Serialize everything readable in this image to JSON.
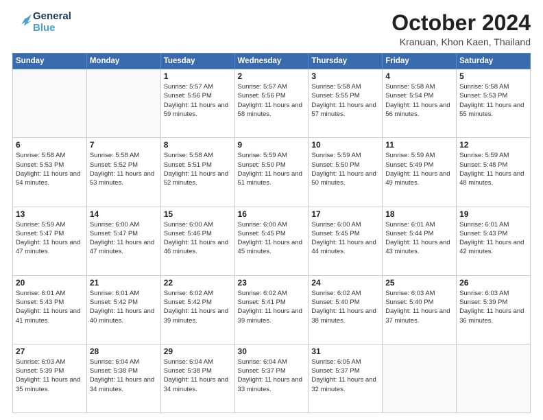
{
  "header": {
    "logo_line1": "General",
    "logo_line2": "Blue",
    "month": "October 2024",
    "location": "Kranuan, Khon Kaen, Thailand"
  },
  "weekdays": [
    "Sunday",
    "Monday",
    "Tuesday",
    "Wednesday",
    "Thursday",
    "Friday",
    "Saturday"
  ],
  "weeks": [
    [
      {
        "day": "",
        "info": ""
      },
      {
        "day": "",
        "info": ""
      },
      {
        "day": "1",
        "info": "Sunrise: 5:57 AM\nSunset: 5:56 PM\nDaylight: 11 hours and 59 minutes."
      },
      {
        "day": "2",
        "info": "Sunrise: 5:57 AM\nSunset: 5:56 PM\nDaylight: 11 hours and 58 minutes."
      },
      {
        "day": "3",
        "info": "Sunrise: 5:58 AM\nSunset: 5:55 PM\nDaylight: 11 hours and 57 minutes."
      },
      {
        "day": "4",
        "info": "Sunrise: 5:58 AM\nSunset: 5:54 PM\nDaylight: 11 hours and 56 minutes."
      },
      {
        "day": "5",
        "info": "Sunrise: 5:58 AM\nSunset: 5:53 PM\nDaylight: 11 hours and 55 minutes."
      }
    ],
    [
      {
        "day": "6",
        "info": "Sunrise: 5:58 AM\nSunset: 5:53 PM\nDaylight: 11 hours and 54 minutes."
      },
      {
        "day": "7",
        "info": "Sunrise: 5:58 AM\nSunset: 5:52 PM\nDaylight: 11 hours and 53 minutes."
      },
      {
        "day": "8",
        "info": "Sunrise: 5:58 AM\nSunset: 5:51 PM\nDaylight: 11 hours and 52 minutes."
      },
      {
        "day": "9",
        "info": "Sunrise: 5:59 AM\nSunset: 5:50 PM\nDaylight: 11 hours and 51 minutes."
      },
      {
        "day": "10",
        "info": "Sunrise: 5:59 AM\nSunset: 5:50 PM\nDaylight: 11 hours and 50 minutes."
      },
      {
        "day": "11",
        "info": "Sunrise: 5:59 AM\nSunset: 5:49 PM\nDaylight: 11 hours and 49 minutes."
      },
      {
        "day": "12",
        "info": "Sunrise: 5:59 AM\nSunset: 5:48 PM\nDaylight: 11 hours and 48 minutes."
      }
    ],
    [
      {
        "day": "13",
        "info": "Sunrise: 5:59 AM\nSunset: 5:47 PM\nDaylight: 11 hours and 47 minutes."
      },
      {
        "day": "14",
        "info": "Sunrise: 6:00 AM\nSunset: 5:47 PM\nDaylight: 11 hours and 47 minutes."
      },
      {
        "day": "15",
        "info": "Sunrise: 6:00 AM\nSunset: 5:46 PM\nDaylight: 11 hours and 46 minutes."
      },
      {
        "day": "16",
        "info": "Sunrise: 6:00 AM\nSunset: 5:45 PM\nDaylight: 11 hours and 45 minutes."
      },
      {
        "day": "17",
        "info": "Sunrise: 6:00 AM\nSunset: 5:45 PM\nDaylight: 11 hours and 44 minutes."
      },
      {
        "day": "18",
        "info": "Sunrise: 6:01 AM\nSunset: 5:44 PM\nDaylight: 11 hours and 43 minutes."
      },
      {
        "day": "19",
        "info": "Sunrise: 6:01 AM\nSunset: 5:43 PM\nDaylight: 11 hours and 42 minutes."
      }
    ],
    [
      {
        "day": "20",
        "info": "Sunrise: 6:01 AM\nSunset: 5:43 PM\nDaylight: 11 hours and 41 minutes."
      },
      {
        "day": "21",
        "info": "Sunrise: 6:01 AM\nSunset: 5:42 PM\nDaylight: 11 hours and 40 minutes."
      },
      {
        "day": "22",
        "info": "Sunrise: 6:02 AM\nSunset: 5:42 PM\nDaylight: 11 hours and 39 minutes."
      },
      {
        "day": "23",
        "info": "Sunrise: 6:02 AM\nSunset: 5:41 PM\nDaylight: 11 hours and 39 minutes."
      },
      {
        "day": "24",
        "info": "Sunrise: 6:02 AM\nSunset: 5:40 PM\nDaylight: 11 hours and 38 minutes."
      },
      {
        "day": "25",
        "info": "Sunrise: 6:03 AM\nSunset: 5:40 PM\nDaylight: 11 hours and 37 minutes."
      },
      {
        "day": "26",
        "info": "Sunrise: 6:03 AM\nSunset: 5:39 PM\nDaylight: 11 hours and 36 minutes."
      }
    ],
    [
      {
        "day": "27",
        "info": "Sunrise: 6:03 AM\nSunset: 5:39 PM\nDaylight: 11 hours and 35 minutes."
      },
      {
        "day": "28",
        "info": "Sunrise: 6:04 AM\nSunset: 5:38 PM\nDaylight: 11 hours and 34 minutes."
      },
      {
        "day": "29",
        "info": "Sunrise: 6:04 AM\nSunset: 5:38 PM\nDaylight: 11 hours and 34 minutes."
      },
      {
        "day": "30",
        "info": "Sunrise: 6:04 AM\nSunset: 5:37 PM\nDaylight: 11 hours and 33 minutes."
      },
      {
        "day": "31",
        "info": "Sunrise: 6:05 AM\nSunset: 5:37 PM\nDaylight: 11 hours and 32 minutes."
      },
      {
        "day": "",
        "info": ""
      },
      {
        "day": "",
        "info": ""
      }
    ]
  ]
}
